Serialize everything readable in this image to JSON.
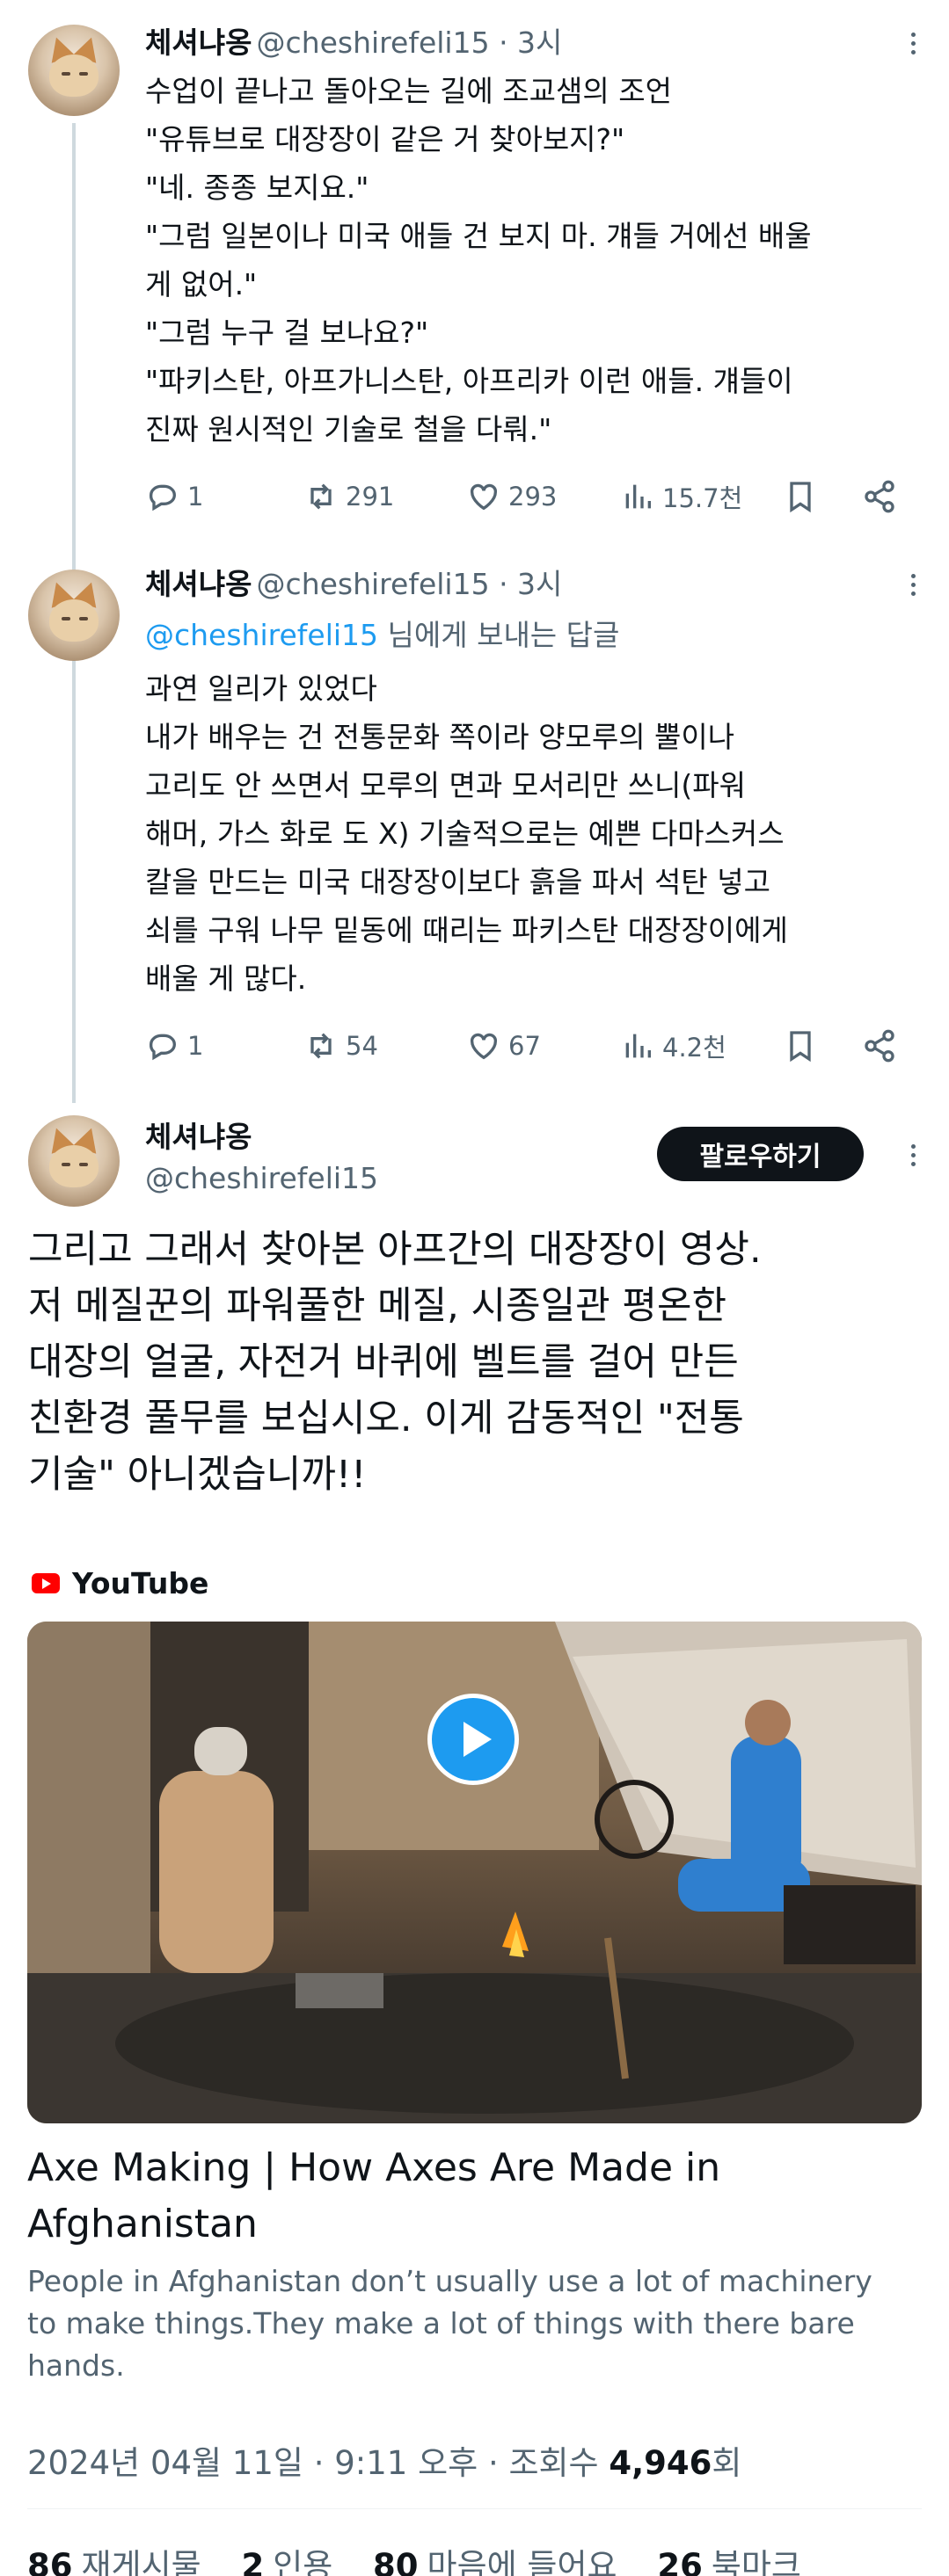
{
  "thread": [
    {
      "name": "체셔냐옹",
      "handle": "@cheshirefeli15 · 3시",
      "lines": [
        "수업이 끝나고 돌아오는 길에 조교샘의 조언",
        "\"유튜브로 대장장이 같은 거 찾아보지?\"",
        "\"네. 종종 보지요.\"",
        "\"그럼 일본이나 미국 애들 건 보지 마. 걔들 거에선 배울",
        "게 없어.\"",
        "\"그럼 누구 걸 보나요?\"",
        "\"파키스탄, 아프가니스탄, 아프리카 이런 애들. 걔들이",
        "진짜 원시적인 기술로 철을 다뤄.\""
      ],
      "replies": "1",
      "reposts": "291",
      "likes": "293",
      "views": "15.7천"
    },
    {
      "name": "체셔냐옹",
      "handle": "@cheshirefeli15 · 3시",
      "reply_to_handle": "@cheshirefeli15",
      "reply_to_suffix": " 님에게 보내는 답글",
      "lines": [
        "과연 일리가 있었다",
        "내가 배우는 건 전통문화 쪽이라 양모루의 뿔이나",
        "고리도 안 쓰면서 모루의 면과 모서리만 쓰니(파워",
        "해머, 가스 화로 도 X) 기술적으로는 예쁜 다마스커스",
        "칼을 만드는 미국 대장장이보다 흙을 파서 석탄 넣고",
        "쇠를 구워 나무 밑동에 때리는 파키스탄 대장장이에게",
        "배울 게 많다."
      ],
      "replies": "1",
      "reposts": "54",
      "likes": "67",
      "views": "4.2천"
    }
  ],
  "main_tweet": {
    "name": "체셔냐옹",
    "handle": "@cheshirefeli15",
    "follow_label": "팔로우하기",
    "lines": [
      "그리고 그래서 찾아본 아프간의 대장장이 영상.",
      "저 메질꾼의 파워풀한 메질, 시종일관 평온한",
      "대장의 얼굴, 자전거 바퀴에 벨트를 걸어 만든",
      "친환경 풀무를 보십시오. 이게 감동적인 \"전통",
      "기술\" 아니겠습니까!!"
    ],
    "card": {
      "source": "YouTube",
      "title_lines": [
        "Axe Making | How Axes Are Made in",
        "Afghanistan"
      ],
      "desc_lines": [
        "People in Afghanistan don’t usually use a lot of machinery",
        "to make things.They make a lot of things with there bare",
        "hands."
      ]
    },
    "meta_prefix": "2024년 04월 11일 · 9:11 오후 · 조회수 ",
    "meta_views": "4,946",
    "meta_suffix": "회",
    "stats": [
      {
        "count": "86",
        "label": "재게시물"
      },
      {
        "count": "2",
        "label": "인용"
      },
      {
        "count": "80",
        "label": "마음에 들어요"
      },
      {
        "count": "26",
        "label": "북마크"
      }
    ]
  }
}
